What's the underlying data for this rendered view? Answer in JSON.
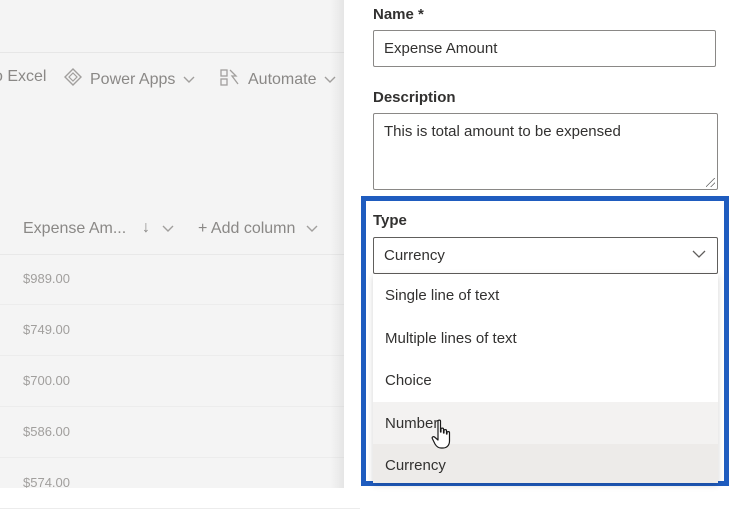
{
  "commandbar": {
    "excel_label": "o Excel",
    "powerapps_label": "Power Apps",
    "automate_label": "Automate",
    "powerapps_icon": "power-apps-icon",
    "automate_icon": "automate-icon"
  },
  "list": {
    "column_name": "Expense Am...",
    "sort_indicator": "↓",
    "add_column_label": "+ Add column",
    "rows": [
      "$989.00",
      "$749.00",
      "$700.00",
      "$586.00",
      "$574.00"
    ]
  },
  "panel": {
    "name_label": "Name *",
    "name_value": "Expense Amount",
    "description_label": "Description",
    "description_value": "This is total amount to be expensed",
    "type_label": "Type",
    "type_value": "Currency",
    "type_options": [
      "Single line of text",
      "Multiple lines of text",
      "Choice",
      "Number",
      "Currency"
    ],
    "hovered_option": "Number",
    "selected_option": "Currency"
  },
  "colors": {
    "highlight_border": "#1f5cbf",
    "option_hover": "#f3f2f1"
  }
}
